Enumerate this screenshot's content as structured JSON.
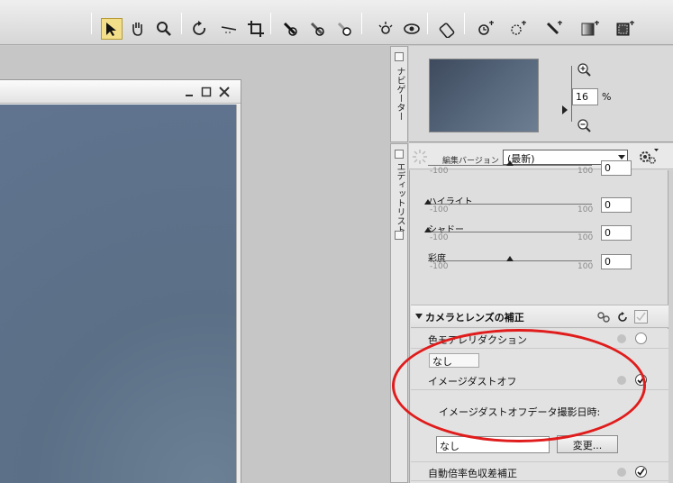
{
  "toolbar": {
    "tools": [
      {
        "icon": "select-arrow-icon"
      },
      {
        "icon": "hand-icon"
      },
      {
        "icon": "zoom-icon"
      },
      {
        "icon": "rotate-icon"
      },
      {
        "icon": "straighten-icon"
      },
      {
        "icon": "crop-icon"
      },
      {
        "icon": "black-point-dropper-icon"
      },
      {
        "icon": "gray-point-dropper-icon"
      },
      {
        "icon": "white-point-dropper-icon"
      },
      {
        "icon": "red-eye-icon"
      },
      {
        "icon": "eye-icon"
      },
      {
        "icon": "auto-retouch-icon"
      },
      {
        "icon": "control-point-icon"
      },
      {
        "icon": "selection-lasso-icon"
      },
      {
        "icon": "brush-icon"
      },
      {
        "icon": "gradient-icon"
      },
      {
        "icon": "fill-icon"
      }
    ]
  },
  "navigator": {
    "tab_label": "ナビゲーター",
    "zoom_value": "16",
    "zoom_unit": "%"
  },
  "edit_list": {
    "tab_label": "エディットリスト",
    "version_label": "編集バージョン",
    "version_value": "(最新)",
    "sliders": [
      {
        "name": "",
        "min": "-100",
        "max": "100",
        "value": "0",
        "level": 0.5
      },
      {
        "name": "ハイライト",
        "min": "-100",
        "max": "100",
        "value": "0",
        "level": 0.0
      },
      {
        "name": "シャドー",
        "min": "-100",
        "max": "100",
        "value": "0",
        "level": 0.0
      },
      {
        "name": "彩度",
        "min": "-100",
        "max": "100",
        "value": "0",
        "level": 0.5
      }
    ],
    "section": {
      "title": "カメラとレンズの補正",
      "items": {
        "moire": "色モアレリダクション",
        "moire_value": "なし",
        "dust_off": "イメージダストオフ",
        "dust_off_date_label": "イメージダストオフデータ撮影日時:",
        "dust_off_value": "なし",
        "change_button": "変更...",
        "auto_ca": "自動倍率色収差補正"
      }
    }
  }
}
